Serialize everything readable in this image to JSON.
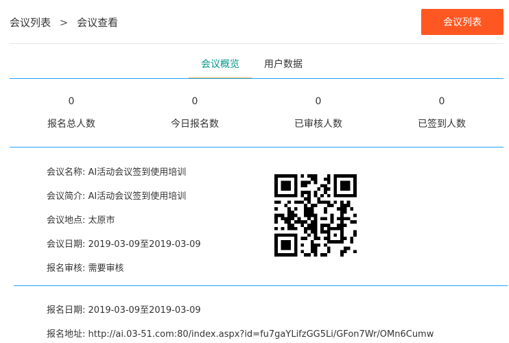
{
  "breadcrumb": {
    "parent": "会议列表",
    "separator": ">",
    "current": "会议查看"
  },
  "header": {
    "list_button": "会议列表"
  },
  "tabs": [
    {
      "label": "会议概览",
      "active": true
    },
    {
      "label": "用户数据",
      "active": false
    }
  ],
  "stats": [
    {
      "value": "0",
      "label": "报名总人数"
    },
    {
      "value": "0",
      "label": "今日报名数"
    },
    {
      "value": "0",
      "label": "已审核人数"
    },
    {
      "value": "0",
      "label": "已签到人数"
    }
  ],
  "meeting": {
    "name": {
      "label": "会议名称:",
      "value": "AI活动会议签到使用培训"
    },
    "intro": {
      "label": "会议简介:",
      "value": "AI活动会议签到使用培训"
    },
    "location": {
      "label": "会议地点:",
      "value": "太原市"
    },
    "date": {
      "label": "会议日期:",
      "value": "2019-03-09至2019-03-09"
    },
    "review": {
      "label": "报名审核:",
      "value": "需要审核"
    }
  },
  "registration": {
    "date": {
      "label": "报名日期:",
      "value": "2019-03-09至2019-03-09"
    },
    "address": {
      "label": "报名地址:",
      "value": "http://ai.03-51.com:80/index.aspx?id=fu7gaYLifzGG5Li/GFon7Wr/OMn6Cumw"
    }
  },
  "colors": {
    "accent": "#ff5722",
    "tab_active": "#009688",
    "divider": "#1e9fff"
  },
  "qr_icon": "qr-code-icon"
}
